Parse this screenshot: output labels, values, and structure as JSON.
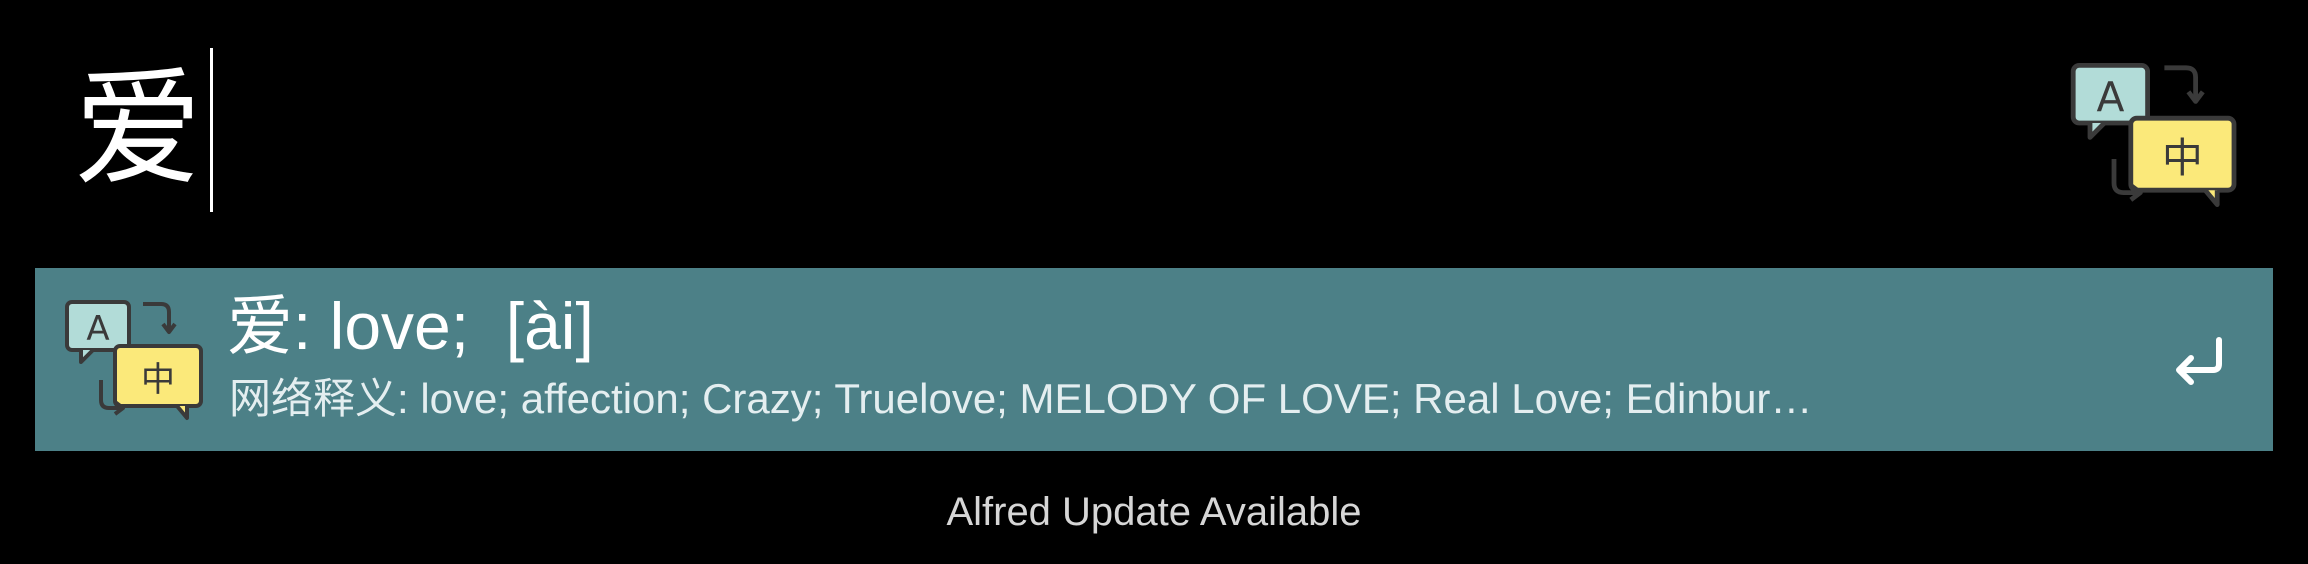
{
  "app": "Alfred",
  "search": {
    "query": "爱"
  },
  "workflow_icon": "translate-a-zh-icon",
  "results": [
    {
      "title_word": "爱",
      "title_rest": ": love;  [ài]",
      "subtitle": "网络释义: love; affection; Crazy; Truelove; MELODY OF LOVE; Real Love; Edinbur…",
      "icon": "translate-a-zh-icon",
      "action_icon": "return-key-icon",
      "selected": true
    }
  ],
  "translate_icon_letters": {
    "latin": "A",
    "chinese": "中"
  },
  "status": {
    "text": "Alfred Update Available"
  },
  "colors": {
    "background": "#000000",
    "selected_row": "#4c8087",
    "bubble_teal": "#b2dcd8",
    "bubble_yellow": "#fbe97a",
    "bubble_outline": "#3a3a3a"
  }
}
